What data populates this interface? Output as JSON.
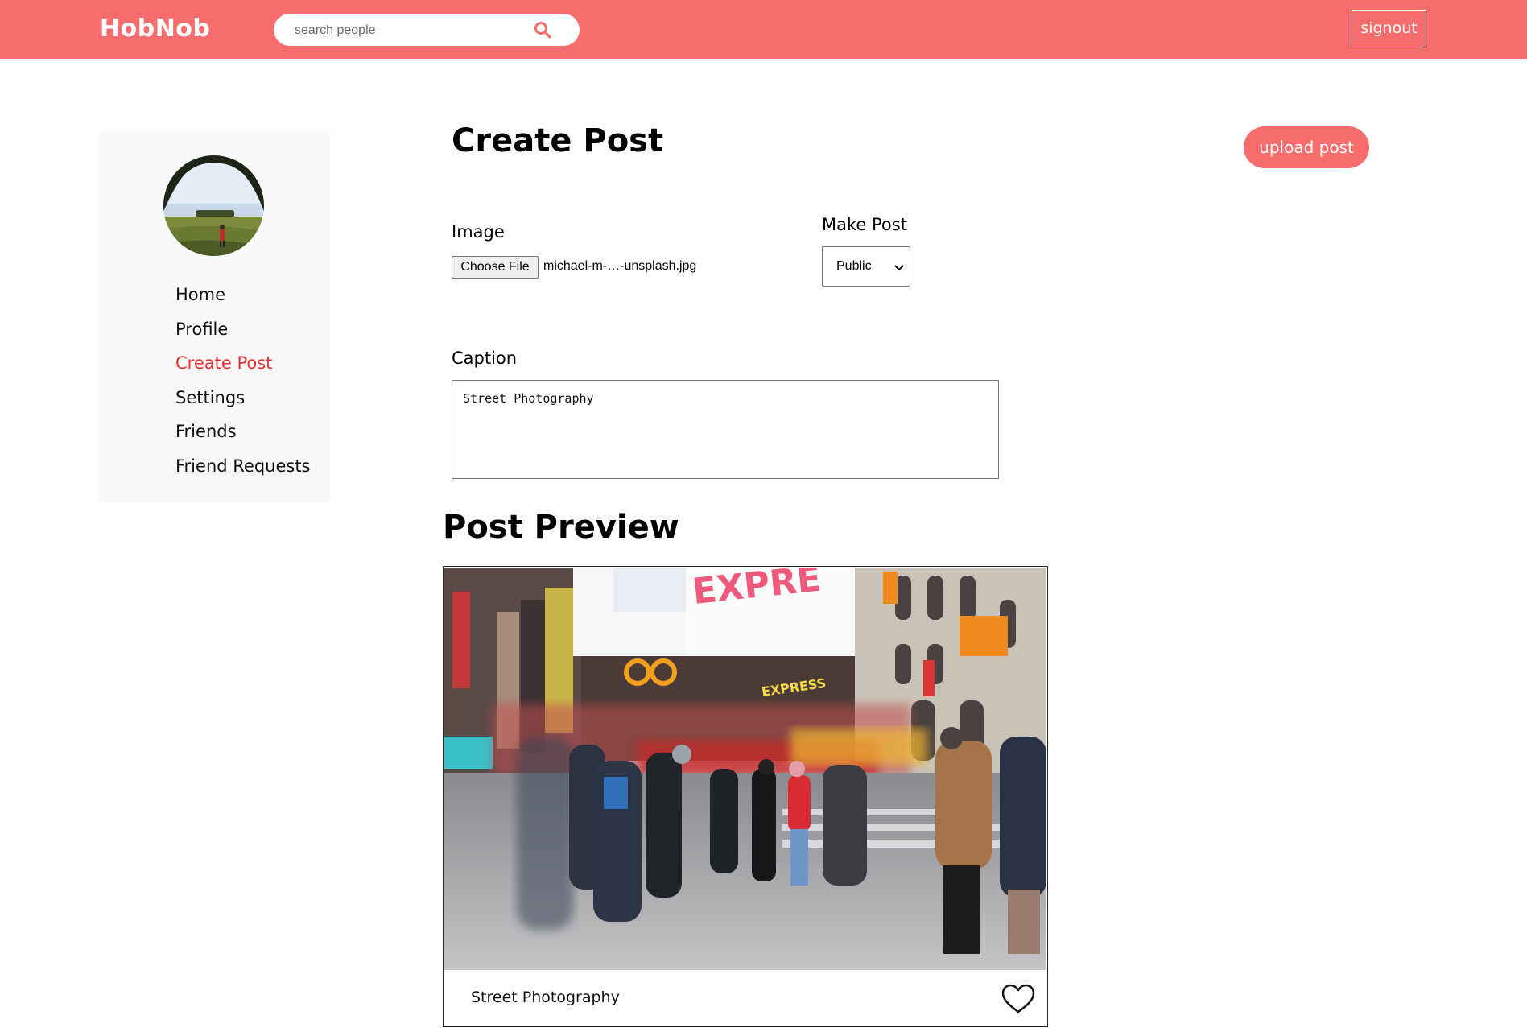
{
  "header": {
    "brand": "HobNob",
    "search_placeholder": "search people",
    "signout_label": "signout"
  },
  "sidebar": {
    "items": [
      {
        "label": "Home",
        "active": false
      },
      {
        "label": "Profile",
        "active": false
      },
      {
        "label": "Create Post",
        "active": true
      },
      {
        "label": "Settings",
        "active": false
      },
      {
        "label": "Friends",
        "active": false
      },
      {
        "label": "Friend Requests",
        "active": false
      }
    ]
  },
  "main": {
    "title": "Create Post",
    "upload_label": "upload post",
    "image_label": "Image",
    "choose_file_label": "Choose File",
    "file_name": "michael-m-…-unsplash.jpg",
    "visibility_label": "Make Post",
    "visibility_value": "Public",
    "caption_label": "Caption",
    "caption_value": "Street Photography"
  },
  "preview": {
    "title": "Post Preview",
    "caption": "Street Photography"
  },
  "colors": {
    "brand": "#f76c6c",
    "active_nav": "#e63232"
  },
  "icons": {
    "search": "search-icon",
    "select": "chevron-down-icon",
    "like": "heart-icon"
  }
}
